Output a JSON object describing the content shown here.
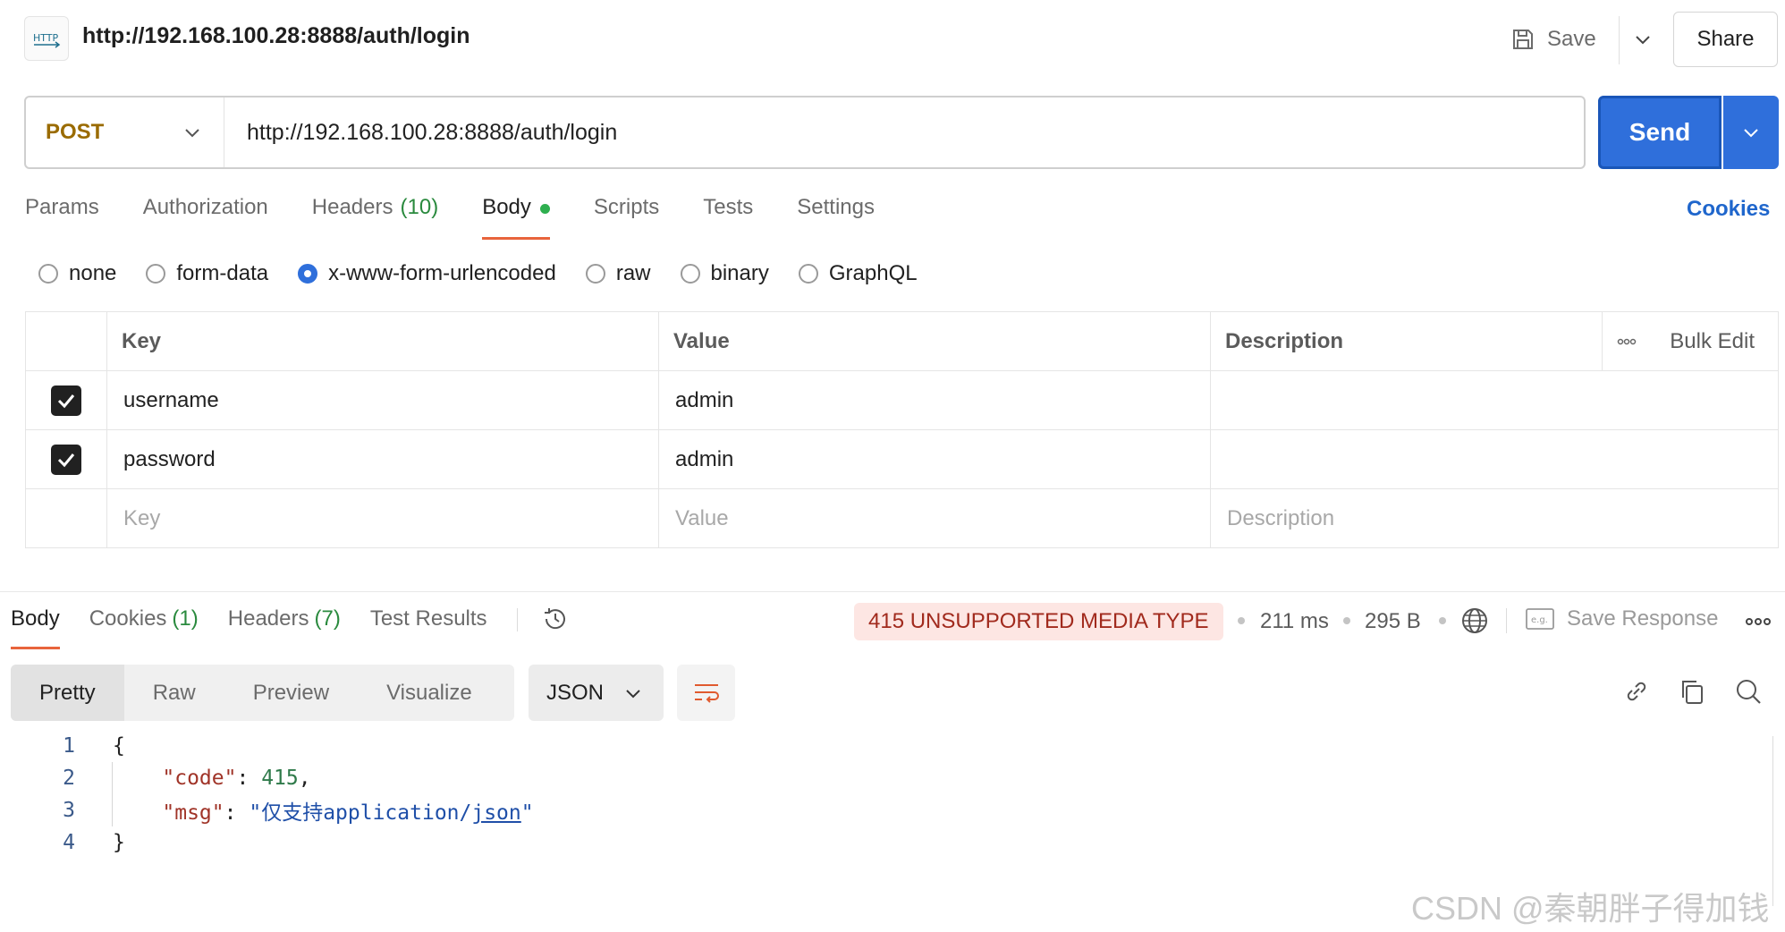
{
  "header": {
    "icon_text": "HTTP",
    "title": "http://192.168.100.28:8888/auth/login",
    "save_label": "Save",
    "share_label": "Share"
  },
  "request": {
    "method": "POST",
    "url": "http://192.168.100.28:8888/auth/login",
    "send_label": "Send"
  },
  "request_tabs": [
    {
      "label": "Params",
      "count": ""
    },
    {
      "label": "Authorization",
      "count": ""
    },
    {
      "label": "Headers",
      "count": "(10)"
    },
    {
      "label": "Body",
      "count": ""
    },
    {
      "label": "Scripts",
      "count": ""
    },
    {
      "label": "Tests",
      "count": ""
    },
    {
      "label": "Settings",
      "count": ""
    }
  ],
  "cookies_link": "Cookies",
  "body_types": {
    "none": "none",
    "form_data": "form-data",
    "urlencoded": "x-www-form-urlencoded",
    "raw": "raw",
    "binary": "binary",
    "graphql": "GraphQL",
    "selected": "x-www-form-urlencoded"
  },
  "params_table": {
    "headers": {
      "key": "Key",
      "value": "Value",
      "description": "Description",
      "bulk_edit": "Bulk Edit"
    },
    "rows": [
      {
        "checked": true,
        "key": "username",
        "value": "admin",
        "description": ""
      },
      {
        "checked": true,
        "key": "password",
        "value": "admin",
        "description": ""
      }
    ],
    "placeholders": {
      "key": "Key",
      "value": "Value",
      "description": "Description"
    }
  },
  "response": {
    "tabs": [
      {
        "label": "Body",
        "count": ""
      },
      {
        "label": "Cookies",
        "count": "(1)"
      },
      {
        "label": "Headers",
        "count": "(7)"
      },
      {
        "label": "Test Results",
        "count": ""
      }
    ],
    "status": "415 UNSUPPORTED MEDIA TYPE",
    "time": "211 ms",
    "size": "295 B",
    "save_response_label": "Save Response",
    "save_response_icon_text": "e.g.",
    "format_tabs": [
      "Pretty",
      "Raw",
      "Preview",
      "Visualize"
    ],
    "language": "JSON",
    "code": {
      "line_numbers": [
        "1",
        "2",
        "3",
        "4"
      ],
      "open_brace": "{",
      "close_brace": "}",
      "code_key": "\"code\"",
      "code_value": "415",
      "msg_key": "\"msg\"",
      "msg_value_prefix": "\"仅支持application/",
      "msg_value_link": "json",
      "msg_value_suffix": "\""
    }
  },
  "watermark": "CSDN @秦朝胖子得加钱",
  "colors": {
    "send_blue": "#2f6fdb",
    "method_post": "#9a6b00",
    "active_tab_underline": "#e8643c",
    "status_error_bg": "#fde6e3",
    "status_error_text": "#a12a1d",
    "count_green": "#2a8a3e"
  }
}
